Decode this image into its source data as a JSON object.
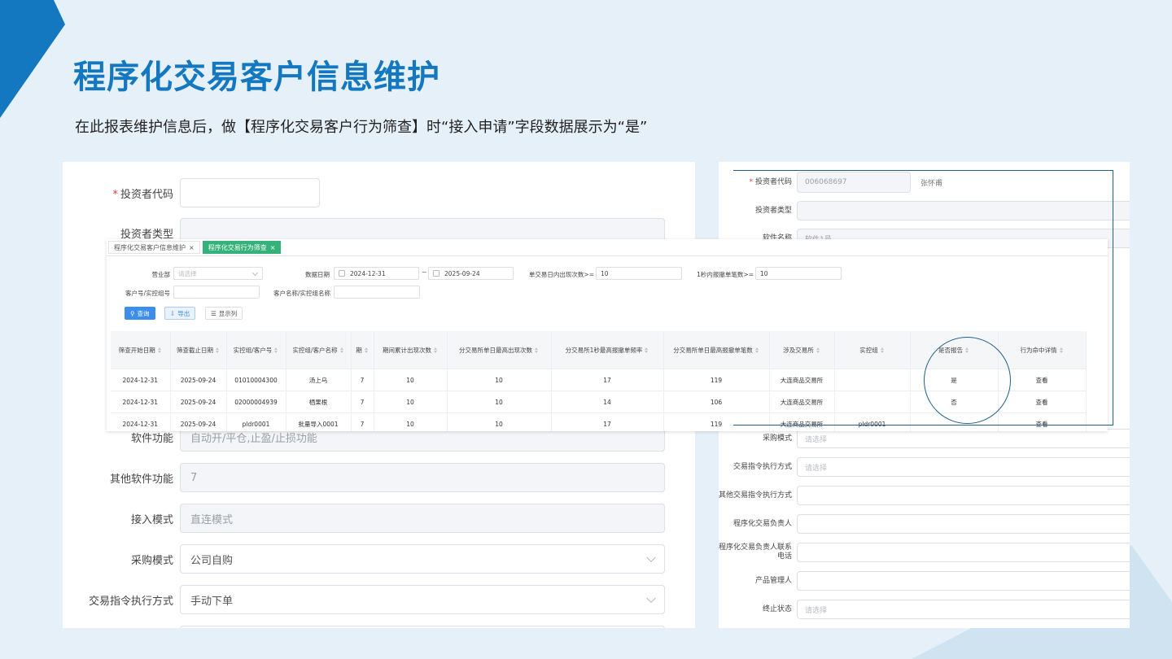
{
  "title": "程序化交易客户信息维护",
  "subtitle": "在此报表维护信息后，做【程序化交易客户行为筛查】时“接入申请”字段数据展示为“是”",
  "colors": {
    "accent": "#1478c0",
    "tab_active": "#34b27a",
    "link": "#3b8eea",
    "highlight_ring": "#1e5f8c"
  },
  "left_form": {
    "investor_code_label": "投资者代码",
    "investor_code_value": "",
    "investor_type_label": "投资者类型",
    "software_function_label": "软件功能",
    "software_function_value": "自动开/平仓,止盈/止损功能",
    "other_software_label": "其他软件功能",
    "other_software_value": "7",
    "access_mode_label": "接入模式",
    "access_mode_value": "直连模式",
    "purchase_mode_label": "采购模式",
    "purchase_mode_value": "公司自购",
    "order_exec_label": "交易指令执行方式",
    "order_exec_value": "手动下单"
  },
  "right_form": {
    "investor_code_label": "投资者代码",
    "investor_code_value": "006068697",
    "investor_name": "张怀甫",
    "investor_type_label": "投资者类型",
    "software_name_label": "软件名称",
    "software_name_value": "软件1号",
    "purchase_mode_label": "采购模式",
    "purchase_mode_placeholder": "请选择",
    "order_exec_label": "交易指令执行方式",
    "order_exec_placeholder": "请选择",
    "other_exec_label": "其他交易指令执行方式",
    "manager_label": "程序化交易负责人",
    "manager_phone_label": "程序化交易负责人联系电话",
    "product_manager_label": "产品管理人",
    "termination_label": "终止状态",
    "termination_placeholder": "请选择"
  },
  "overlay": {
    "tabs": [
      {
        "label": "程序化交易客户信息维护",
        "close": "×"
      },
      {
        "label": "程序化交易行为筛查",
        "close": "×"
      }
    ],
    "query": {
      "branch_label": "营业部",
      "branch_placeholder": "请选择",
      "date_label": "数据日期",
      "date_start": "2024-12-31",
      "date_sep": "~",
      "date_end": "2025-09-24",
      "single_day_label": "单交易日内出现次数>=",
      "single_day_value": "10",
      "per_second_label": "1秒内报撤单笔数>=",
      "per_second_value": "10",
      "client_no_label": "客户号/实控组号",
      "client_no_value": "",
      "client_name_label": "客户名称/实控组名称",
      "client_name_value": ""
    },
    "buttons": {
      "query": "查询",
      "export": "导出",
      "columns": "显示列"
    },
    "table": {
      "headers": [
        "筛查开始日期",
        "筛查截止日期",
        "实控组/客户号",
        "实控组/客户名称",
        "期",
        "期间累计出现次数",
        "分交易所单日最高出现次数",
        "分交易所1秒最高报撤单频率",
        "分交易所单日最高报撤单笔数",
        "涉及交易所",
        "实控组",
        "是否报告",
        "行为命中详情"
      ],
      "rows": [
        [
          "2024-12-31",
          "2025-09-24",
          "01010004300",
          "汤上乌",
          "7",
          "10",
          "10",
          "17",
          "119",
          "大连商品交易所",
          "",
          "是",
          "查看"
        ],
        [
          "2024-12-31",
          "2025-09-24",
          "02000004939",
          "栖果根",
          "7",
          "10",
          "10",
          "14",
          "106",
          "大连商品交易所",
          "",
          "否",
          "查看"
        ],
        [
          "2024-12-31",
          "2025-09-24",
          "pldr0001",
          "批量导入0001",
          "7",
          "10",
          "10",
          "17",
          "119",
          "大连商品交易所",
          "pldr0001",
          "",
          "查看"
        ]
      ]
    }
  }
}
